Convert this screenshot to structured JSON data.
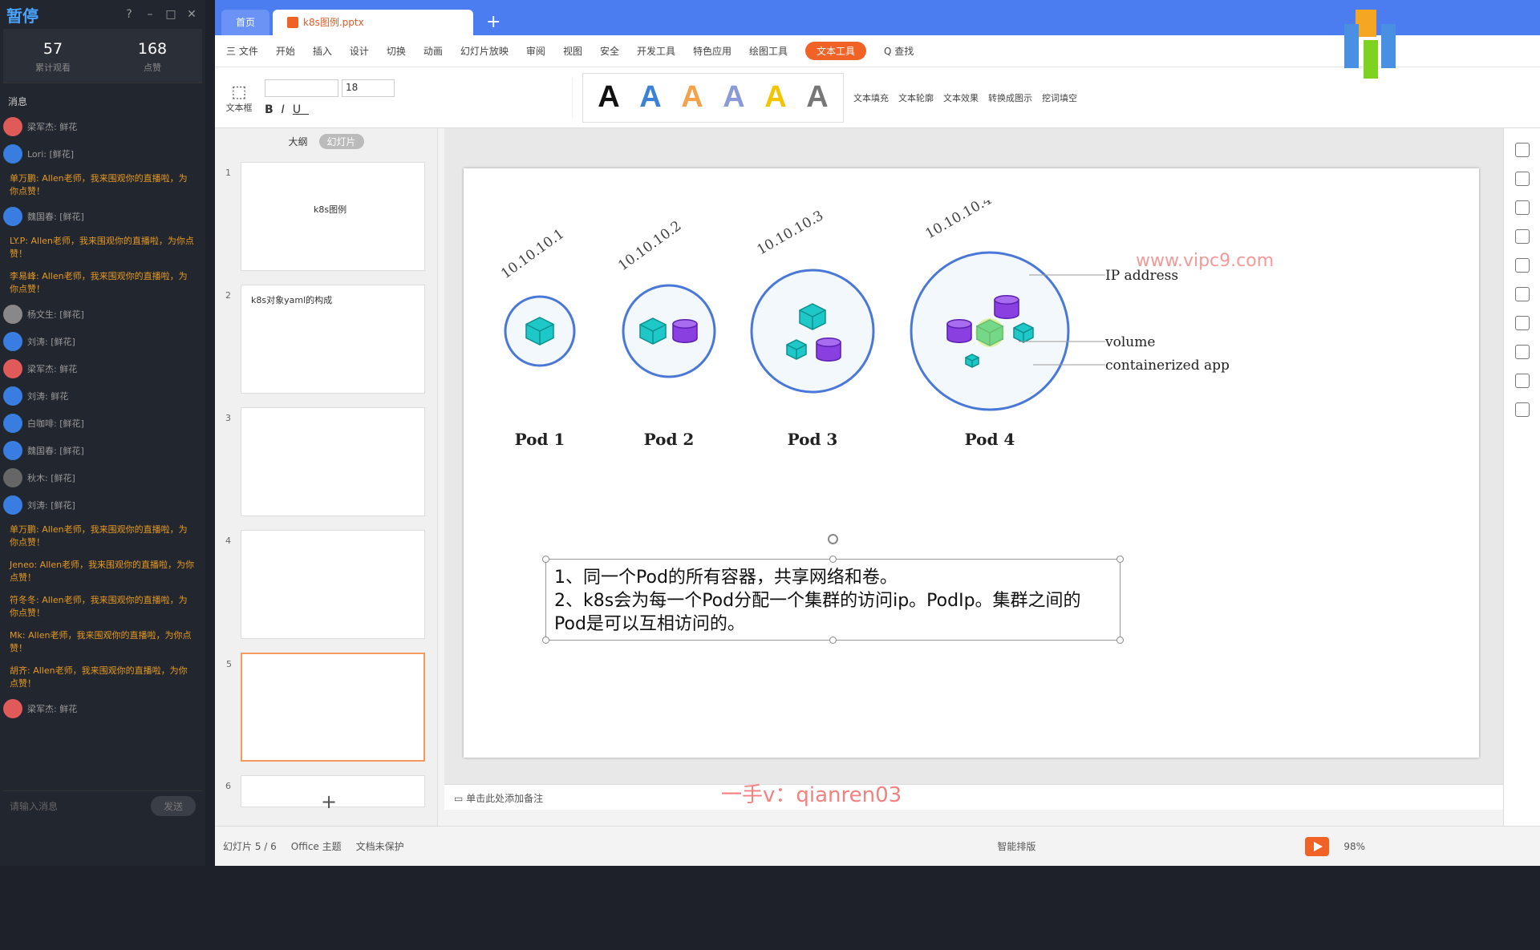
{
  "live": {
    "title": "暂停",
    "viewers": "57",
    "viewers_label": "累计观看",
    "likes": "168",
    "likes_label": "点赞",
    "messages_title": "消息",
    "input_placeholder": "请输入消息",
    "send": "发送",
    "messages": [
      {
        "type": "gift",
        "text": "梁军杰: 鲜花",
        "color": "#e05a5a"
      },
      {
        "type": "gift",
        "text": "Lori: [鲜花]",
        "color": "#3a7de0"
      },
      {
        "type": "chat",
        "text": "单万鹏: Allen老师，我来围观你的直播啦，为你点赞！"
      },
      {
        "type": "gift",
        "text": "魏国春: [鲜花]",
        "color": "#3a7de0"
      },
      {
        "type": "chat",
        "text": "LY.P: Allen老师，我来围观你的直播啦，为你点赞！"
      },
      {
        "type": "chat",
        "text": "李易峰: Allen老师，我来围观你的直播啦，为你点赞！"
      },
      {
        "type": "gift",
        "text": "杨文生: [鲜花]",
        "color": "#888"
      },
      {
        "type": "gift",
        "text": "刘涛: [鲜花]",
        "color": "#3a7de0"
      },
      {
        "type": "gift",
        "text": "梁军杰: 鲜花",
        "color": "#e05a5a"
      },
      {
        "type": "gift",
        "text": "刘涛: 鲜花",
        "color": "#3a7de0"
      },
      {
        "type": "gift",
        "text": "白咖啡: [鲜花]",
        "color": "#3a7de0"
      },
      {
        "type": "gift",
        "text": "魏国春: [鲜花]",
        "color": "#3a7de0"
      },
      {
        "type": "gift",
        "text": "秋木: [鲜花]",
        "color": "#666"
      },
      {
        "type": "gift",
        "text": "刘涛: [鲜花]",
        "color": "#3a7de0"
      },
      {
        "type": "chat",
        "text": "单万鹏: Allen老师，我来围观你的直播啦，为你点赞！"
      },
      {
        "type": "chat",
        "text": "Jeneo: Allen老师，我来围观你的直播啦，为你点赞！"
      },
      {
        "type": "chat",
        "text": "符冬冬: Allen老师，我来围观你的直播啦，为你点赞！"
      },
      {
        "type": "chat",
        "text": "Mk: Allen老师，我来围观你的直播啦，为你点赞！"
      },
      {
        "type": "chat",
        "text": "胡齐: Allen老师，我来围观你的直播啦，为你点赞！"
      },
      {
        "type": "gift",
        "text": "梁军杰: 鲜花",
        "color": "#e05a5a"
      }
    ]
  },
  "tabs": {
    "home": "首页",
    "doc": "k8s图例.pptx"
  },
  "menu": [
    "三 文件",
    "开始",
    "插入",
    "设计",
    "切换",
    "动画",
    "幻灯片放映",
    "审阅",
    "视图",
    "安全",
    "开发工具",
    "特色应用",
    "绘图工具",
    "文本工具",
    "Q 查找"
  ],
  "menu_active": "文本工具",
  "ribbon": {
    "textbox": "文本框",
    "font_size": "18",
    "text_fill": "文本填充",
    "text_outline": "文本轮廓",
    "text_effect": "文本效果",
    "convert": "转换成图示",
    "cloze": "挖词填空",
    "styles": [
      "A",
      "A",
      "A",
      "A",
      "A",
      "A"
    ],
    "style_colors": [
      "#111",
      "#3b82d6",
      "#f3a24a",
      "#8a9bd8",
      "#f5c400",
      "#777"
    ]
  },
  "panes": {
    "outline": "大纲",
    "slides": "幻灯片"
  },
  "thumbs": [
    {
      "n": "1",
      "title": "k8s图例"
    },
    {
      "n": "2",
      "title": "k8s对象yaml的构成"
    },
    {
      "n": "3",
      "title": ""
    },
    {
      "n": "4",
      "title": ""
    },
    {
      "n": "5",
      "title": ""
    },
    {
      "n": "6",
      "title": ""
    }
  ],
  "slide": {
    "watermark": "www.vipc9.com",
    "ip_label": "IP address",
    "volume_label": "volume",
    "app_label": "containerized app",
    "pods": [
      {
        "name": "Pod 1",
        "ip": "10.10.10.1"
      },
      {
        "name": "Pod 2",
        "ip": "10.10.10.2"
      },
      {
        "name": "Pod 3",
        "ip": "10.10.10.3"
      },
      {
        "name": "Pod 4",
        "ip": "10.10.10.4"
      }
    ],
    "text_line1": "1、同一个Pod的所有容器，共享网络和卷。",
    "text_line2": "2、k8s会为每一个Pod分配一个集群的访问ip。PodIp。集群之间的Pod是可以互相访问的。"
  },
  "notes": "单击此处添加备注",
  "overlay_watermark": "一手v：qianren03",
  "status": {
    "slide_num": "幻灯片 5 / 6",
    "theme": "Office 主题",
    "protect": "文档未保护",
    "smart": "智能排版",
    "zoom": "98%"
  },
  "colors": {
    "cube": "#1fc8c8",
    "cylinder": "#8a3fe0",
    "ring": "#4a78d8",
    "highlight": "#c9e84a"
  }
}
